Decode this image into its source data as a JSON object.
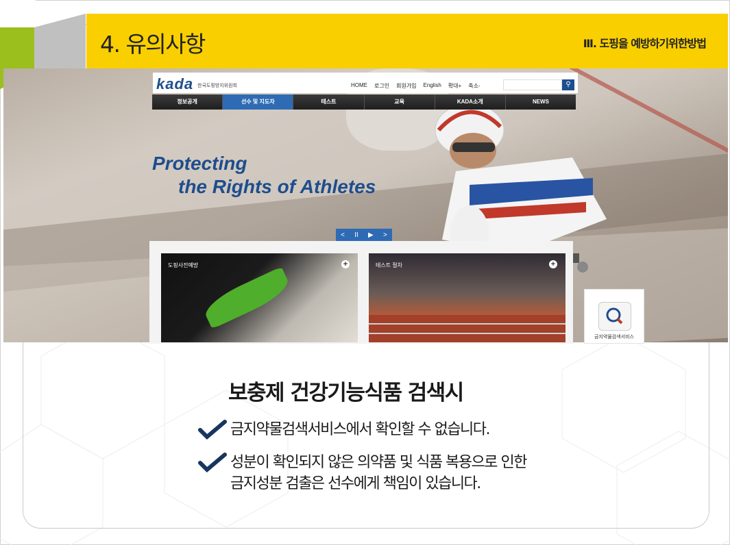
{
  "slide": {
    "title": "4. 유의사항",
    "section": "Ⅲ. 도핑을 예방하기위한방법",
    "heading": "보충제 건강기능식품 검색시",
    "bullets": [
      {
        "line1": "금지약물검색서비스에서 확인할 수 없습니다.",
        "line2": ""
      },
      {
        "line1": "성분이 확인되지 않은 의약품 및 식품 복용으로 인한",
        "line2": "금지성분 검출은 선수에게 책임이 있습니다."
      }
    ]
  },
  "site": {
    "logo": "kada",
    "logo_sub": "한국도핑방지위원회",
    "top_links": [
      "HOME",
      "로그인",
      "회원가입",
      "English",
      "확대+",
      "축소-"
    ],
    "nav": [
      "정보공개",
      "선수 및 지도자",
      "테스트",
      "교육",
      "KADA소개",
      "NEWS"
    ],
    "active_nav": "선수 및 지도자",
    "hero_line1": "Protecting",
    "hero_line2": "the Rights of Athletes",
    "slider_controls": [
      "<",
      "II",
      "▶",
      ">"
    ],
    "tiles": [
      "도핑사전예방",
      "테스트 절차"
    ],
    "service_label": "금지약물검색서비스"
  },
  "colors": {
    "header": "#f9cf00",
    "brand_blue": "#1e4d8d",
    "check_navy": "#17355e"
  }
}
